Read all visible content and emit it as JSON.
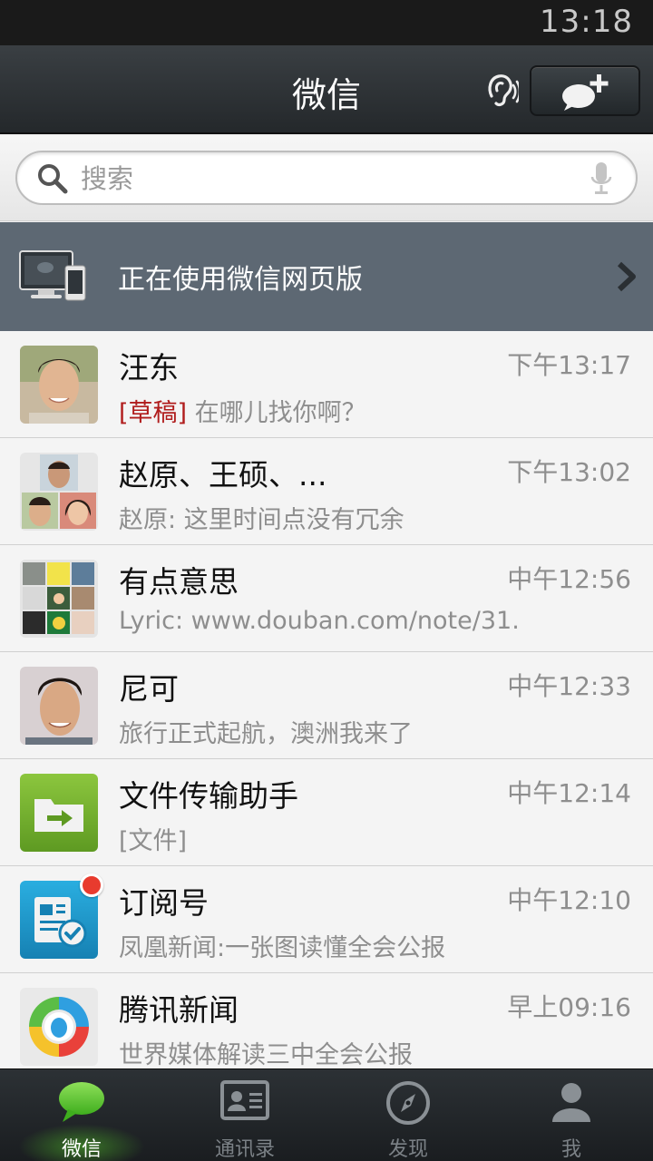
{
  "status_bar": {
    "time": "13:18"
  },
  "header": {
    "title": "微信"
  },
  "search": {
    "placeholder": "搜索"
  },
  "web_banner": {
    "text": "正在使用微信网页版"
  },
  "chats": [
    {
      "name": "汪东",
      "time": "下午13:17",
      "draft_tag": "[草稿]",
      "preview": " 在哪儿找你啊？",
      "unread": false
    },
    {
      "name": "赵原、王硕、...",
      "time": "下午13:02",
      "preview": "赵原: 这里时间点没有冗余",
      "unread": false
    },
    {
      "name": "有点意思",
      "time": "中午12:56",
      "preview": "Lyric: www.douban.com/note/31...",
      "unread": false
    },
    {
      "name": "尼可",
      "time": "中午12:33",
      "preview": "旅行正式起航，澳洲我来了",
      "unread": false
    },
    {
      "name": "文件传输助手",
      "time": "中午12:14",
      "preview": "[文件]",
      "unread": false
    },
    {
      "name": "订阅号",
      "time": "中午12:10",
      "preview": "凤凰新闻:一张图读懂全会公报",
      "unread": true
    },
    {
      "name": "腾讯新闻",
      "time": "早上09:16",
      "preview": "世界媒体解读三中全会公报",
      "unread": false
    }
  ],
  "tabs": [
    {
      "label": "微信",
      "icon": "chat-bubble-icon",
      "active": true
    },
    {
      "label": "通讯录",
      "icon": "contacts-card-icon",
      "active": false
    },
    {
      "label": "发现",
      "icon": "compass-icon",
      "active": false
    },
    {
      "label": "我",
      "icon": "person-icon",
      "active": false
    }
  ],
  "colors": {
    "header_bg": "#2b3034",
    "banner_bg": "#5d6873",
    "active_tab_green": "#5cc233",
    "draft_red": "#b01c1c",
    "unread_red": "#e83b2e"
  }
}
